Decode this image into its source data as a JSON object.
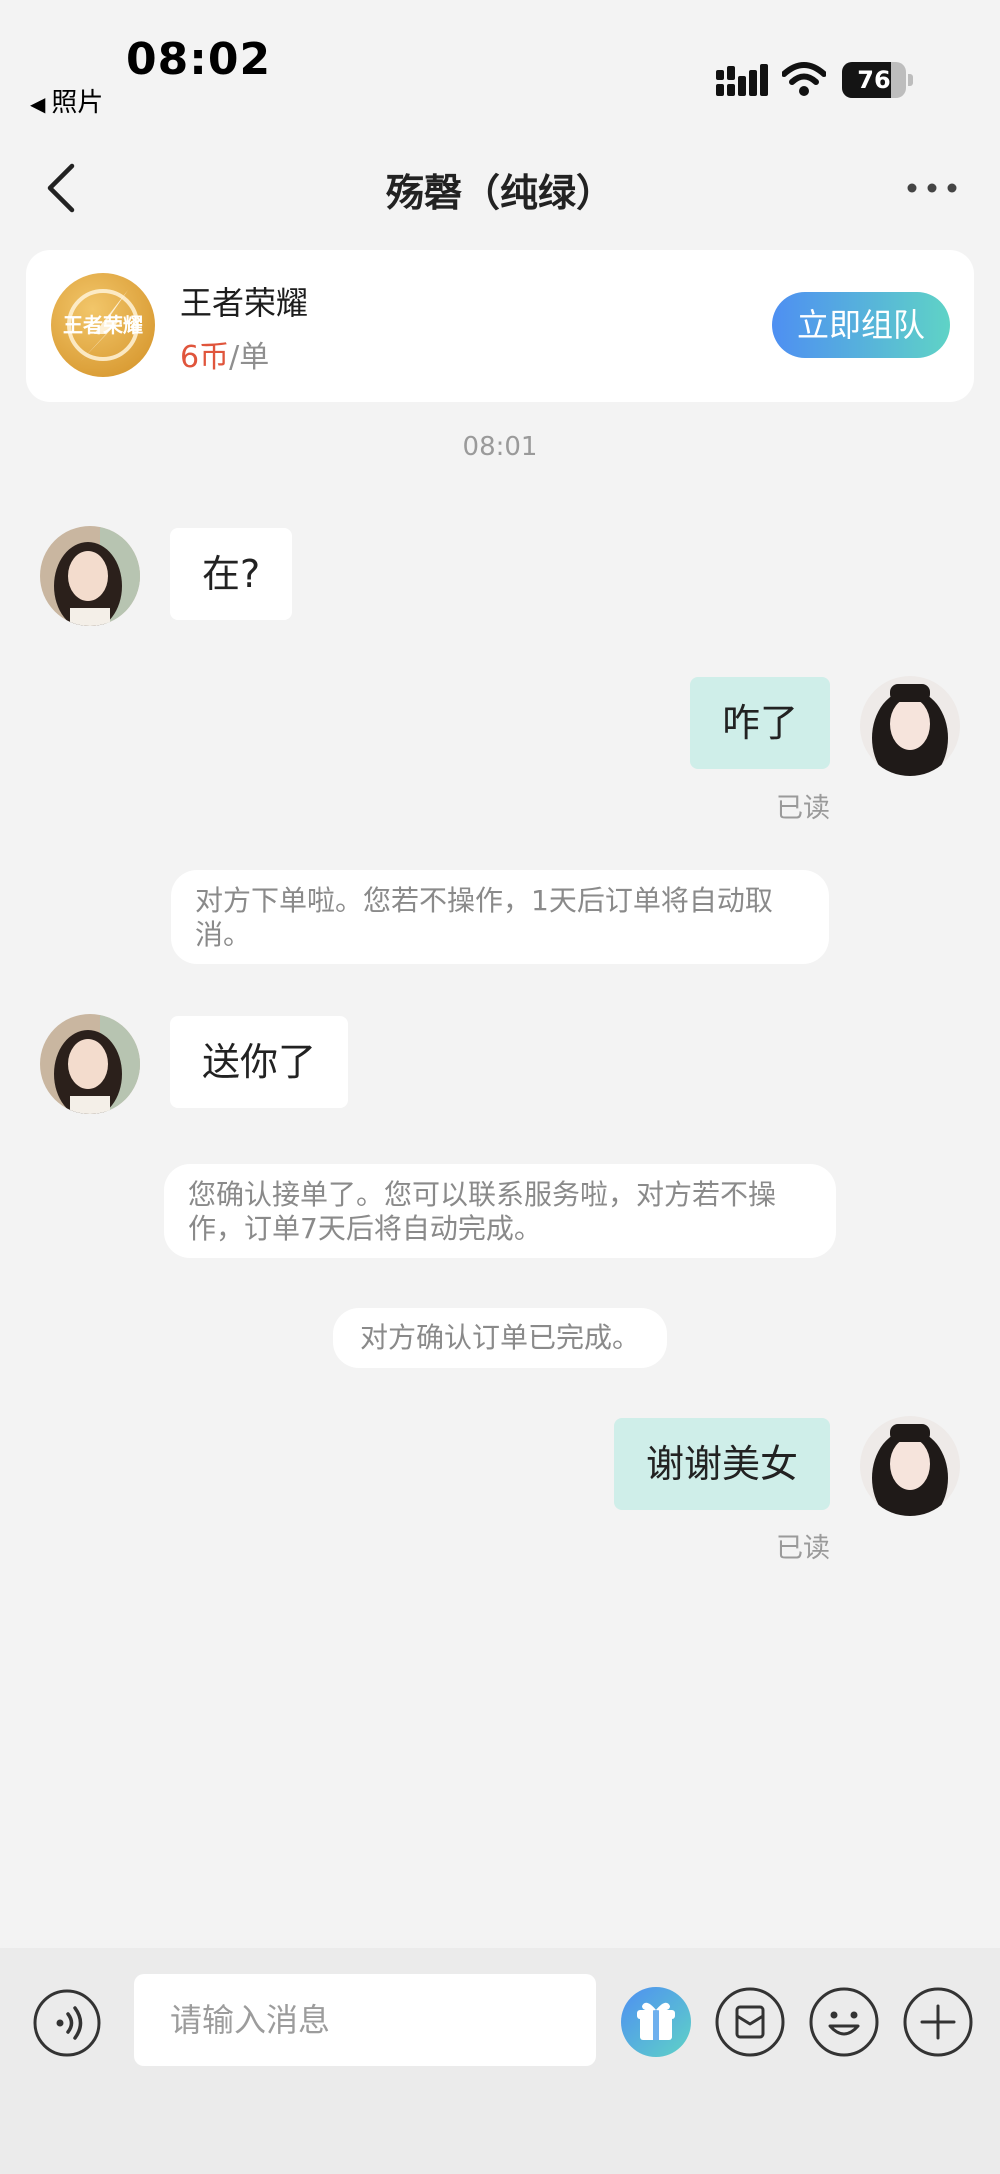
{
  "status_bar": {
    "time": "08:02",
    "back_app": "照片",
    "battery_level": "76",
    "battery_fraction": 0.76
  },
  "nav": {
    "title": "殇磬（纯绿）"
  },
  "service_card": {
    "game_name": "王者荣耀",
    "logo_text": "王者荣耀",
    "price": "6币",
    "price_unit": "/单",
    "team_button": "立即组队"
  },
  "chat": {
    "time_label": "08:01",
    "messages": [
      {
        "side": "in",
        "text": "在?"
      },
      {
        "side": "out",
        "text": "咋了",
        "read": "已读"
      },
      {
        "type": "notice",
        "text": "对方下单啦。您若不操作，1天后订单将自动取消。"
      },
      {
        "side": "in",
        "text": "送你了"
      },
      {
        "type": "notice",
        "text": "您确认接单了。您可以联系服务啦，对方若不操作，订单7天后将自动完成。"
      },
      {
        "type": "notice",
        "text": "对方确认订单已完成。"
      },
      {
        "side": "out",
        "text": "谢谢美女",
        "read": "已读"
      }
    ]
  },
  "input_bar": {
    "placeholder": "请输入消息",
    "icons": [
      "voice-icon",
      "gift-icon",
      "order-icon",
      "emoji-icon",
      "plus-icon"
    ]
  },
  "colors": {
    "accent_gradient_start": "#4e8ff2",
    "accent_gradient_end": "#5fd3c6",
    "outgoing_bubble": "#cfeee9",
    "price_red": "#e0553c"
  }
}
